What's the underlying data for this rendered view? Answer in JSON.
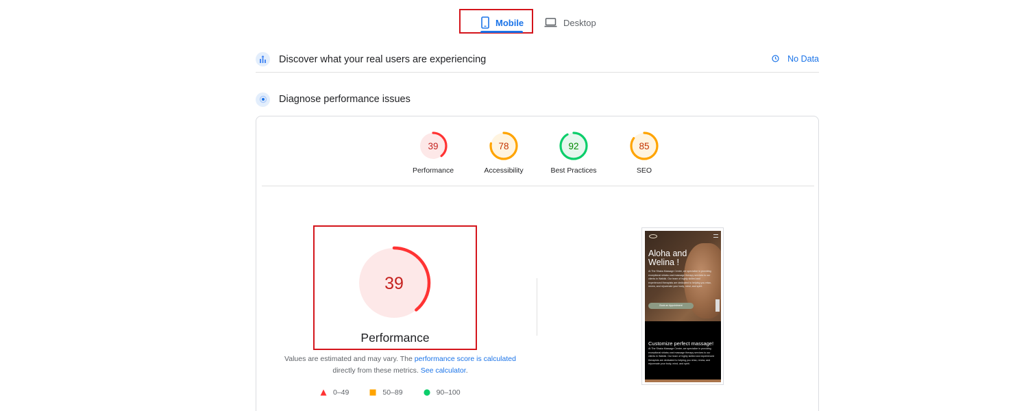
{
  "tabs": {
    "mobile_label": "Mobile",
    "desktop_label": "Desktop",
    "active": "Mobile"
  },
  "sections": {
    "real_users": {
      "title": "Discover what your real users are experiencing",
      "status": "No Data"
    },
    "diagnose": {
      "title": "Diagnose performance issues"
    }
  },
  "scores": [
    {
      "label": "Performance",
      "value": "39",
      "level": "fail"
    },
    {
      "label": "Accessibility",
      "value": "78",
      "level": "average"
    },
    {
      "label": "Best Practices",
      "value": "92",
      "level": "pass"
    },
    {
      "label": "SEO",
      "value": "85",
      "level": "average"
    }
  ],
  "main_gauge": {
    "value": "39",
    "label": "Performance"
  },
  "note": {
    "text1": "Values are estimated and may vary. The ",
    "link1": "performance score is calculated",
    "text2": " directly from these metrics. ",
    "link2": "See calculator",
    "text3": "."
  },
  "legend": {
    "fail": "0–49",
    "average": "50–89",
    "pass": "90–100"
  },
  "colors": {
    "accent": "#1a73e8",
    "fail": "#ff3333",
    "average": "#ffa400",
    "pass": "#0cce6b",
    "highlight": "#d4141b"
  },
  "preview": {
    "hero_title": "Aloha and Welina !",
    "hero_text": "At The Shaka Massage Center, we specialize in providing exceptional shiatsu and massage therapy services to our clients in Waikiki. Our team of highly skilled and experienced therapists are dedicated to helping you relax, renew, and rejuvenate your body, mind, and spirit.",
    "hero_button": "Book an Appointment",
    "lower_title": "Customize perfect massage!",
    "lower_text": "At The Shaka Massage Center, we specialize in providing exceptional shiatsu and massage therapy services to our clients in Waikiki. Our team of highly skilled and experienced therapists are dedicated to helping you relax, renew, and rejuvenate your body, mind, and spirit."
  }
}
